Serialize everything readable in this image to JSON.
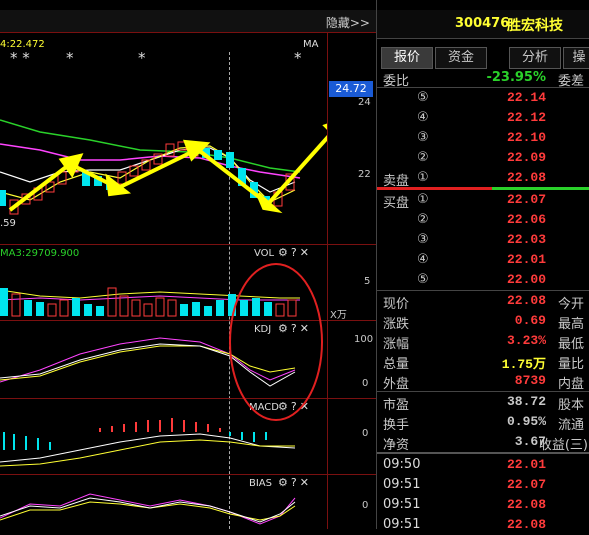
{
  "chart": {
    "hide_label": "隐藏>>",
    "ma_label": "MA",
    "ma_value": "4:22.472",
    "price_box": "24.72",
    "axis_24": "24",
    "axis_22": "22",
    "low_label": ".59",
    "stars_left": "* *",
    "star_a": "*",
    "star_b": "*",
    "star_c": "*",
    "vol": {
      "label": "VOL",
      "ma3": "MA3:29709.900",
      "axis": "5",
      "unit": "X万"
    },
    "kdj": {
      "label": "KDJ",
      "axis_top": "100",
      "axis_bottom": "0"
    },
    "macd": {
      "label": "MACD",
      "axis": "0"
    },
    "bias": {
      "label": "BIAS",
      "axis": "0"
    }
  },
  "header": {
    "code": "300476",
    "name": "胜宏科技"
  },
  "tabs": [
    "报价",
    "资金",
    "分析",
    "操"
  ],
  "weibi": {
    "label": "委比",
    "value": "-23.95%",
    "diff_label": "委差"
  },
  "sell": [
    {
      "label": "",
      "num": "⑤",
      "price": "22.14"
    },
    {
      "label": "",
      "num": "④",
      "price": "22.12"
    },
    {
      "label": "",
      "num": "③",
      "price": "22.10"
    },
    {
      "label": "",
      "num": "②",
      "price": "22.09"
    },
    {
      "label": "卖盘",
      "num": "①",
      "price": "22.08"
    }
  ],
  "buy": [
    {
      "label": "买盘",
      "num": "①",
      "price": "22.07"
    },
    {
      "label": "",
      "num": "②",
      "price": "22.06"
    },
    {
      "label": "",
      "num": "③",
      "price": "22.03"
    },
    {
      "label": "",
      "num": "④",
      "price": "22.01"
    },
    {
      "label": "",
      "num": "⑤",
      "price": "22.00"
    }
  ],
  "stats": [
    {
      "label": "现价",
      "value": "22.08",
      "right": "今开"
    },
    {
      "label": "涨跌",
      "value": "0.69",
      "right": "最高"
    },
    {
      "label": "涨幅",
      "value": "3.23%",
      "right": "最低"
    },
    {
      "label": "总量",
      "value": "1.75万",
      "right": "量比"
    },
    {
      "label": "外盘",
      "value": "8739",
      "right": "内盘"
    }
  ],
  "stats2": [
    {
      "label": "市盈",
      "value": "38.72",
      "right": "股本"
    },
    {
      "label": "换手",
      "value": "0.95%",
      "right": "流通"
    },
    {
      "label": "净资",
      "value": "3.67",
      "right": "收益(三)"
    }
  ],
  "ticks": [
    {
      "time": "09:50",
      "price": "22.01"
    },
    {
      "time": "09:51",
      "price": "22.07"
    },
    {
      "time": "09:51",
      "price": "22.08"
    },
    {
      "time": "09:51",
      "price": "22.08"
    }
  ]
}
